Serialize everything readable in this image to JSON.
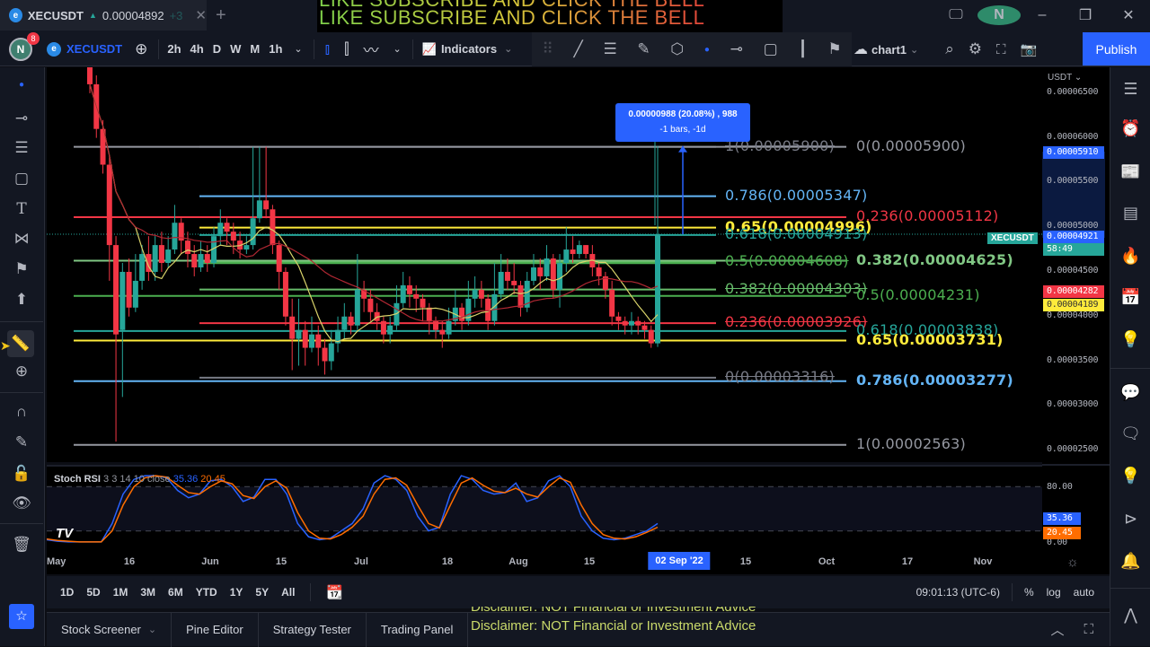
{
  "titlebar": {
    "tab_symbol": "XECUSDT",
    "tab_price": "0.00004892",
    "tab_change": "+3",
    "new_tab": "+",
    "banner_line1": "LIKE SUBSCRIBE AND CLICK THE BELL",
    "banner_line2": "LIKE SUBSCRIBE AND CLICK THE BELL",
    "user_initial": "N",
    "window_controls": [
      "minimize",
      "restore",
      "close"
    ]
  },
  "toolbar": {
    "user_initial": "N",
    "notification_count": "8",
    "symbol": "XECUSDT",
    "timeframes": [
      "2h",
      "4h",
      "D",
      "W",
      "M",
      "1h"
    ],
    "active_timeframe": "D",
    "indicators_label": "Indicators",
    "layout_name": "chart1",
    "publish_label": "Publish"
  },
  "left_tools": [
    "crosshair-dot",
    "horizontal-line",
    "fib-retracement",
    "rectangle",
    "text",
    "pattern",
    "forecast",
    "arrow-up",
    "ruler",
    "zoom-in",
    "magnet",
    "lock-drawing",
    "lock",
    "eye",
    "trash",
    "favorites-star"
  ],
  "right_tools": [
    "watchlist",
    "alerts",
    "news",
    "data-window",
    "hotlist",
    "calendar",
    "ideas",
    "chats",
    "messages",
    "idea-stream",
    "streams",
    "notifications",
    "signals"
  ],
  "chart_data": {
    "type": "candlestick",
    "symbol": "XECUSDT",
    "quote_currency": "USDT",
    "interval": "D",
    "y_axis_ticks": [
      "0.00006500",
      "0.00006000",
      "0.00005500",
      "0.00005000",
      "0.00004500",
      "0.00004000",
      "0.00003500",
      "0.00003000",
      "0.00002500"
    ],
    "ylim": [
      2.37e-05,
      6.79e-05
    ],
    "x_axis_ticks": [
      "May",
      "16",
      "Jun",
      "15",
      "Jul",
      "18",
      "Aug",
      "15",
      "02 Sep '22",
      "15",
      "Oct",
      "17",
      "Nov"
    ],
    "highlighted_date": "02 Sep '22",
    "last_price": "0.00004921",
    "countdown": "58:49",
    "price_labels": [
      {
        "value": "0.00005910",
        "color": "#2962ff"
      },
      {
        "value": "0.00004921",
        "color": "#2962ff",
        "sub": "58:49"
      },
      {
        "value": "0.00004282",
        "color": "#f23645"
      },
      {
        "value": "0.00004189",
        "color": "#ffeb3b"
      }
    ],
    "moving_averages": [
      {
        "name": "MA short",
        "color": "#d9d36a"
      },
      {
        "name": "MA long",
        "color": "#b22833"
      }
    ],
    "candles_approx": [
      [
        6.9e-05,
        6.6e-05,
        7e-05,
        6.5e-05
      ],
      [
        6.6e-05,
        6.1e-05,
        6.7e-05,
        6e-05
      ],
      [
        6.1e-05,
        5.7e-05,
        6.2e-05,
        5.6e-05
      ],
      [
        5.7e-05,
        4.8e-05,
        5.8e-05,
        4.4e-05
      ],
      [
        4.8e-05,
        3.8e-05,
        4.9e-05,
        2.6e-05
      ],
      [
        3.85e-05,
        4.5e-05,
        4.6e-05,
        3.1e-05
      ],
      [
        4.5e-05,
        4.1e-05,
        4.65e-05,
        4e-05
      ],
      [
        4.1e-05,
        4.4e-05,
        4.7e-05,
        4.05e-05
      ],
      [
        4.4e-05,
        4.7e-05,
        4.8e-05,
        4.3e-05
      ],
      [
        4.7e-05,
        4.5e-05,
        4.9e-05,
        4.4e-05
      ],
      [
        4.5e-05,
        4.8e-05,
        4.9e-05,
        4.4e-05
      ],
      [
        4.8e-05,
        4.6e-05,
        4.95e-05,
        4.5e-05
      ],
      [
        4.6e-05,
        4.75e-05,
        4.9e-05,
        4.55e-05
      ],
      [
        4.75e-05,
        5.05e-05,
        5.25e-05,
        4.7e-05
      ],
      [
        5.05e-05,
        4.85e-05,
        5.1e-05,
        4.7e-05
      ],
      [
        4.85e-05,
        4.7e-05,
        4.95e-05,
        4.55e-05
      ],
      [
        4.7e-05,
        4.55e-05,
        4.8e-05,
        4.45e-05
      ],
      [
        4.55e-05,
        4.7e-05,
        4.85e-05,
        4.5e-05
      ],
      [
        4.7e-05,
        4.6e-05,
        4.8e-05,
        4.5e-05
      ],
      [
        4.6e-05,
        4.9e-05,
        5e-05,
        4.55e-05
      ],
      [
        4.9e-05,
        5.05e-05,
        5.2e-05,
        4.8e-05
      ],
      [
        5.05e-05,
        4.95e-05,
        5.1e-05,
        4.8e-05
      ],
      [
        4.95e-05,
        4.85e-05,
        5.05e-05,
        4.7e-05
      ],
      [
        4.85e-05,
        4.75e-05,
        4.95e-05,
        4.65e-05
      ],
      [
        4.75e-05,
        4.8e-05,
        4.9e-05,
        4.7e-05
      ],
      [
        4.8e-05,
        5.1e-05,
        5.9e-05,
        4.75e-05
      ],
      [
        5.1e-05,
        5.3e-05,
        5.9e-05,
        5.05e-05
      ],
      [
        5.3e-05,
        5.2e-05,
        5.9e-05,
        5.1e-05
      ],
      [
        5.2e-05,
        4.8e-05,
        5.25e-05,
        4.7e-05
      ],
      [
        4.8e-05,
        4.5e-05,
        4.85e-05,
        4.3e-05
      ],
      [
        4.5e-05,
        4e-05,
        4.55e-05,
        3.9e-05
      ],
      [
        4e-05,
        3.75e-05,
        4.2e-05,
        3.4e-05
      ],
      [
        3.75e-05,
        3.85e-05,
        4.2e-05,
        3.45e-05
      ],
      [
        3.85e-05,
        3.65e-05,
        3.95e-05,
        3.45e-05
      ],
      [
        3.65e-05,
        3.8e-05,
        4e-05,
        3.6e-05
      ],
      [
        3.8e-05,
        3.65e-05,
        3.9e-05,
        3.45e-05
      ],
      [
        3.65e-05,
        3.5e-05,
        3.75e-05,
        3.35e-05
      ],
      [
        3.5e-05,
        3.7e-05,
        3.85e-05,
        3.4e-05
      ],
      [
        3.7e-05,
        3.85e-05,
        4e-05,
        3.6e-05
      ],
      [
        3.85e-05,
        4e-05,
        4.15e-05,
        3.75e-05
      ],
      [
        4e-05,
        3.9e-05,
        4.05e-05,
        3.8e-05
      ],
      [
        3.9e-05,
        4.3e-05,
        4.7e-05,
        3.85e-05
      ],
      [
        4.3e-05,
        4.2e-05,
        4.4e-05,
        4.05e-05
      ],
      [
        4.2e-05,
        4.05e-05,
        4.3e-05,
        3.95e-05
      ],
      [
        4.05e-05,
        3.95e-05,
        4.15e-05,
        3.85e-05
      ],
      [
        3.95e-05,
        3.8e-05,
        4e-05,
        3.7e-05
      ],
      [
        3.8e-05,
        3.9e-05,
        4e-05,
        3.7e-05
      ],
      [
        3.9e-05,
        4.15e-05,
        4.35e-05,
        3.85e-05
      ],
      [
        4.15e-05,
        4.35e-05,
        4.5e-05,
        4.1e-05
      ],
      [
        4.35e-05,
        4.25e-05,
        4.45e-05,
        4.1e-05
      ],
      [
        4.25e-05,
        4.2e-05,
        4.35e-05,
        4.05e-05
      ],
      [
        4.2e-05,
        4.1e-05,
        4.25e-05,
        3.95e-05
      ],
      [
        4.1e-05,
        3.95e-05,
        4.15e-05,
        3.8e-05
      ],
      [
        3.95e-05,
        3.85e-05,
        4e-05,
        3.75e-05
      ],
      [
        3.85e-05,
        3.8e-05,
        3.95e-05,
        3.65e-05
      ],
      [
        3.8e-05,
        3.95e-05,
        4.1e-05,
        3.75e-05
      ],
      [
        3.95e-05,
        4.1e-05,
        4.3e-05,
        3.9e-05
      ],
      [
        4.1e-05,
        3.95e-05,
        4.15e-05,
        3.85e-05
      ],
      [
        3.95e-05,
        4.2e-05,
        4.4e-05,
        3.9e-05
      ],
      [
        4.2e-05,
        4.3e-05,
        4.45e-05,
        4.1e-05
      ],
      [
        4.3e-05,
        4.2e-05,
        4.4e-05,
        4.1e-05
      ],
      [
        4.2e-05,
        3.95e-05,
        4.25e-05,
        3.85e-05
      ],
      [
        3.95e-05,
        4.25e-05,
        4.6e-05,
        3.9e-05
      ],
      [
        4.25e-05,
        4.5e-05,
        4.7e-05,
        4.2e-05
      ],
      [
        4.5e-05,
        4.4e-05,
        4.65e-05,
        4.3e-05
      ],
      [
        4.4e-05,
        4.35e-05,
        4.6e-05,
        4.25e-05
      ],
      [
        4.35e-05,
        4.1e-05,
        4.4e-05,
        4e-05
      ],
      [
        4.1e-05,
        4.4e-05,
        4.5e-05,
        4.05e-05
      ],
      [
        4.4e-05,
        4.55e-05,
        4.7e-05,
        4.35e-05
      ],
      [
        4.55e-05,
        4.45e-05,
        4.65e-05,
        4.3e-05
      ],
      [
        4.45e-05,
        4.65e-05,
        4.8e-05,
        4.4e-05
      ],
      [
        4.65e-05,
        4.3e-05,
        4.7e-05,
        4.2e-05
      ],
      [
        4.3e-05,
        4.6e-05,
        4.7e-05,
        4.1e-05
      ],
      [
        4.6e-05,
        4.75e-05,
        5e-05,
        4.5e-05
      ],
      [
        4.75e-05,
        4.7e-05,
        4.9e-05,
        4.6e-05
      ],
      [
        4.7e-05,
        4.8e-05,
        4.85e-05,
        4.65e-05
      ],
      [
        4.8e-05,
        4.7e-05,
        4.8e-05,
        4.65e-05
      ],
      [
        4.7e-05,
        4.55e-05,
        4.8e-05,
        4.45e-05
      ],
      [
        4.55e-05,
        4.45e-05,
        4.6e-05,
        4.35e-05
      ],
      [
        4.45e-05,
        4.3e-05,
        4.5e-05,
        4.2e-05
      ],
      [
        4.3e-05,
        4e-05,
        4.4e-05,
        3.9e-05
      ],
      [
        4e-05,
        3.95e-05,
        4.05e-05,
        3.85e-05
      ],
      [
        3.95e-05,
        3.9e-05,
        4e-05,
        3.8e-05
      ],
      [
        3.9e-05,
        3.95e-05,
        4.05e-05,
        3.8e-05
      ],
      [
        3.95e-05,
        3.9e-05,
        4e-05,
        3.8e-05
      ],
      [
        3.9e-05,
        3.85e-05,
        3.95e-05,
        3.75e-05
      ],
      [
        3.85e-05,
        3.7e-05,
        3.9e-05,
        3.65e-05
      ],
      [
        3.7e-05,
        4.92e-05,
        5.91e-05,
        3.66e-05
      ]
    ],
    "fib_levels_left": [
      {
        "ratio": "1",
        "price": "0.00005900",
        "color": "#787b86",
        "strike": true
      },
      {
        "ratio": "0.786",
        "price": "0.00005347",
        "color": "#64b5f6",
        "strike": false
      },
      {
        "ratio": "0.65",
        "price": "0.00004996",
        "color": "#ffeb3b",
        "strike": false
      },
      {
        "ratio": "0.618",
        "price": "0.00004913",
        "color": "#26a69a",
        "strike": true
      },
      {
        "ratio": "0.5",
        "price": "0.00004608",
        "color": "#4caf50",
        "strike": true
      },
      {
        "ratio": "0.382",
        "price": "0.00004303",
        "color": "#66bb6a",
        "strike": true
      },
      {
        "ratio": "0.236",
        "price": "0.00003926",
        "color": "#f23645",
        "strike": true
      },
      {
        "ratio": "0",
        "price": "0.00003316",
        "color": "#787b86",
        "strike": true
      }
    ],
    "fib_levels_right": [
      {
        "ratio": "0",
        "price": "0.00005900",
        "color": "#9598a1"
      },
      {
        "ratio": "0.236",
        "price": "0.00005112",
        "color": "#f23645"
      },
      {
        "ratio": "0.382",
        "price": "0.00004625",
        "color": "#81c784"
      },
      {
        "ratio": "0.5",
        "price": "0.00004231",
        "color": "#4caf50"
      },
      {
        "ratio": "0.618",
        "price": "0.00003838",
        "color": "#26a69a"
      },
      {
        "ratio": "0.65",
        "price": "0.00003731",
        "color": "#ffeb3b"
      },
      {
        "ratio": "0.786",
        "price": "0.00003277",
        "color": "#64b5f6"
      },
      {
        "ratio": "1",
        "price": "0.00002563",
        "color": "#9598a1"
      }
    ],
    "measure_tooltip": {
      "line1": "0.00000988 (20.08%) , 988",
      "line2": "-1 bars, -1d"
    },
    "stoch_rsi": {
      "title": "Stoch RSI",
      "params": "3 3 14 10 close",
      "k_value": "35.36",
      "d_value": "20.45",
      "k_color": "#2962ff",
      "d_color": "#ff6d00",
      "levels": [
        80,
        50,
        20
      ],
      "y_ticks": [
        "80.00",
        "0.00"
      ],
      "ylim": [
        0,
        100
      ],
      "k_series": [
        8,
        6,
        5,
        5,
        5,
        5,
        30,
        70,
        90,
        95,
        95,
        92,
        75,
        65,
        70,
        88,
        90,
        80,
        60,
        66,
        90,
        90,
        70,
        30,
        12,
        8,
        10,
        20,
        30,
        50,
        85,
        95,
        90,
        75,
        40,
        20,
        25,
        70,
        95,
        90,
        75,
        70,
        72,
        85,
        60,
        65,
        88,
        95,
        80,
        40,
        20,
        10,
        8,
        10,
        15,
        20,
        30
      ],
      "d_series": [
        9,
        7,
        6,
        5,
        5,
        5,
        20,
        55,
        80,
        92,
        95,
        93,
        82,
        72,
        70,
        80,
        88,
        84,
        68,
        64,
        80,
        88,
        78,
        45,
        20,
        10,
        9,
        15,
        25,
        40,
        70,
        90,
        92,
        82,
        55,
        30,
        24,
        55,
        85,
        92,
        82,
        74,
        72,
        78,
        70,
        66,
        80,
        92,
        86,
        55,
        30,
        15,
        10,
        9,
        12,
        18,
        25
      ]
    }
  },
  "time_axis": {
    "clock": "09:01:13 (UTC-6)",
    "percent": "%",
    "log": "log",
    "auto": "auto"
  },
  "range_buttons": [
    "1D",
    "5D",
    "1M",
    "3M",
    "6M",
    "YTD",
    "1Y",
    "5Y",
    "All"
  ],
  "bottom_tabs": [
    "Stock Screener",
    "Pine Editor",
    "Strategy Tester",
    "Trading Panel"
  ],
  "disclaimer": {
    "line1": "Disclaimer: NOT Financial  or Investment Advice",
    "line2": "Disclaimer: NOT Financial  or Investment Advice"
  },
  "watermark": "TV"
}
